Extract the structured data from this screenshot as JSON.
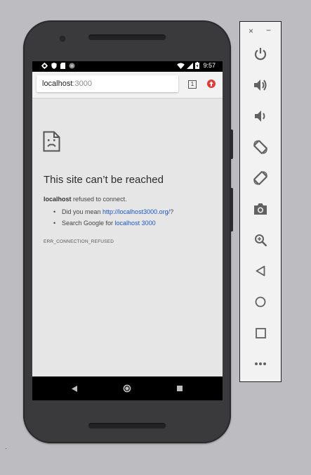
{
  "statusbar": {
    "icons": [
      "settings-icon",
      "shield-icon",
      "sd-card-icon",
      "sync-icon"
    ],
    "right_icons": [
      "wifi-icon",
      "signal-icon",
      "battery-icon"
    ],
    "time": "9:57"
  },
  "browser": {
    "url_host": "localhost",
    "url_port": ":3000",
    "tab_count": "1",
    "update_icon": "update-available-icon"
  },
  "error_page": {
    "icon": "sad-page-icon",
    "title": "This site can’t be reached",
    "host_bold": "localhost",
    "refused_text": " refused to connect.",
    "did_you_mean_prefix": "Did you mean ",
    "did_you_mean_link": "http://localhost3000.org/",
    "did_you_mean_suffix": "?",
    "search_prefix": "Search Google for ",
    "search_link": "localhost 3000",
    "error_code": "ERR_CONNECTION_REFUSED"
  },
  "navbar": {
    "items": [
      "back-icon",
      "home-icon",
      "recents-icon"
    ]
  },
  "emulator_panel": {
    "close_label": "×",
    "minimize_label": "−",
    "tools": [
      "power-icon",
      "volume-up-icon",
      "volume-down-icon",
      "rotate-left-icon",
      "rotate-right-icon",
      "camera-icon",
      "zoom-icon",
      "back-icon",
      "home-icon",
      "overview-icon",
      "more-icon"
    ]
  },
  "colors": {
    "link": "#1a56c8",
    "update_badge": "#e53935",
    "panel_icon": "#616161"
  }
}
